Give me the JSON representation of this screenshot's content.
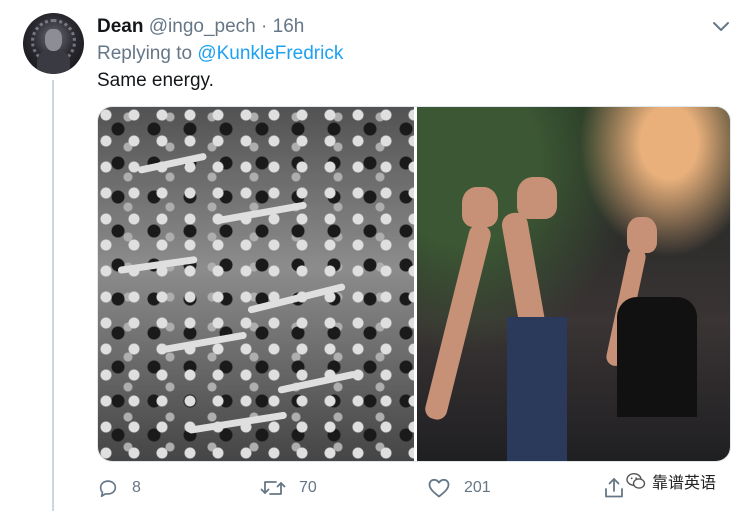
{
  "tweet": {
    "display_name": "Dean",
    "handle": "@ingo_pech",
    "separator": "·",
    "time": "16h",
    "replying_prefix": "Replying to",
    "replying_to": "@KunkleFredrick",
    "text": "Same energy."
  },
  "actions": {
    "reply_count": "8",
    "retweet_count": "70",
    "like_count": "201"
  },
  "watermark": {
    "text": "靠谱英语"
  },
  "colors": {
    "accent": "#1da1f2",
    "muted": "#657786",
    "text": "#14171a",
    "thread_line": "#ccd6dd"
  },
  "icons": {
    "caret": "chevron-down-icon",
    "reply": "speech-bubble-icon",
    "retweet": "retweet-icon",
    "like": "heart-icon",
    "share": "share-icon"
  }
}
